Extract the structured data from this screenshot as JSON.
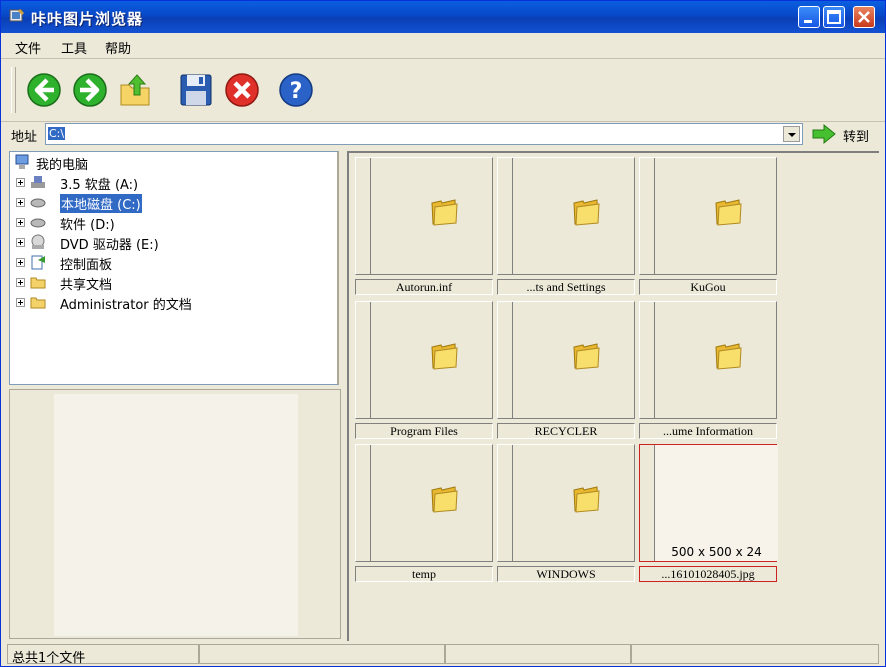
{
  "window": {
    "title": "咔咔图片浏览器"
  },
  "menu": [
    "文件",
    "工具",
    "帮助"
  ],
  "toolbar": {
    "buttons": [
      "back-icon",
      "forward-icon",
      "up-folder-icon",
      "save-icon",
      "delete-icon",
      "help-icon"
    ]
  },
  "address": {
    "label": "地址",
    "value": "C:\\",
    "go_label": "转到"
  },
  "tree": {
    "items": [
      {
        "label": "我的电脑",
        "icon": "computer-icon"
      },
      {
        "label": "3.5 软盘 (A:)",
        "icon": "floppy-icon"
      },
      {
        "label": "本地磁盘 (C:)",
        "icon": "harddisk-icon",
        "selected": true
      },
      {
        "label": "软件 (D:)",
        "icon": "harddisk-icon"
      },
      {
        "label": "DVD 驱动器 (E:)",
        "icon": "dvd-icon"
      },
      {
        "label": "控制面板",
        "icon": "control-panel-icon"
      },
      {
        "label": "共享文档",
        "icon": "folder-icon"
      },
      {
        "label": "Administrator 的文档",
        "icon": "folder-icon"
      }
    ]
  },
  "files": [
    {
      "name": "Autorun.inf",
      "type": "folder"
    },
    {
      "name": "...ts and Settings",
      "type": "folder"
    },
    {
      "name": "KuGou",
      "type": "folder"
    },
    {
      "name": "Program Files",
      "type": "folder"
    },
    {
      "name": "RECYCLER",
      "type": "folder"
    },
    {
      "name": "...ume Information",
      "type": "folder"
    },
    {
      "name": "temp",
      "type": "folder"
    },
    {
      "name": "WINDOWS",
      "type": "folder"
    },
    {
      "name": "...16101028405.jpg",
      "type": "image",
      "dims": "500 x 500 x 24",
      "selected": true
    }
  ],
  "status": {
    "text": "总共1个文件"
  },
  "colors": {
    "title_bar": "#0a5fe0",
    "selection": "#316ac5",
    "selected_border": "#cc2222"
  }
}
